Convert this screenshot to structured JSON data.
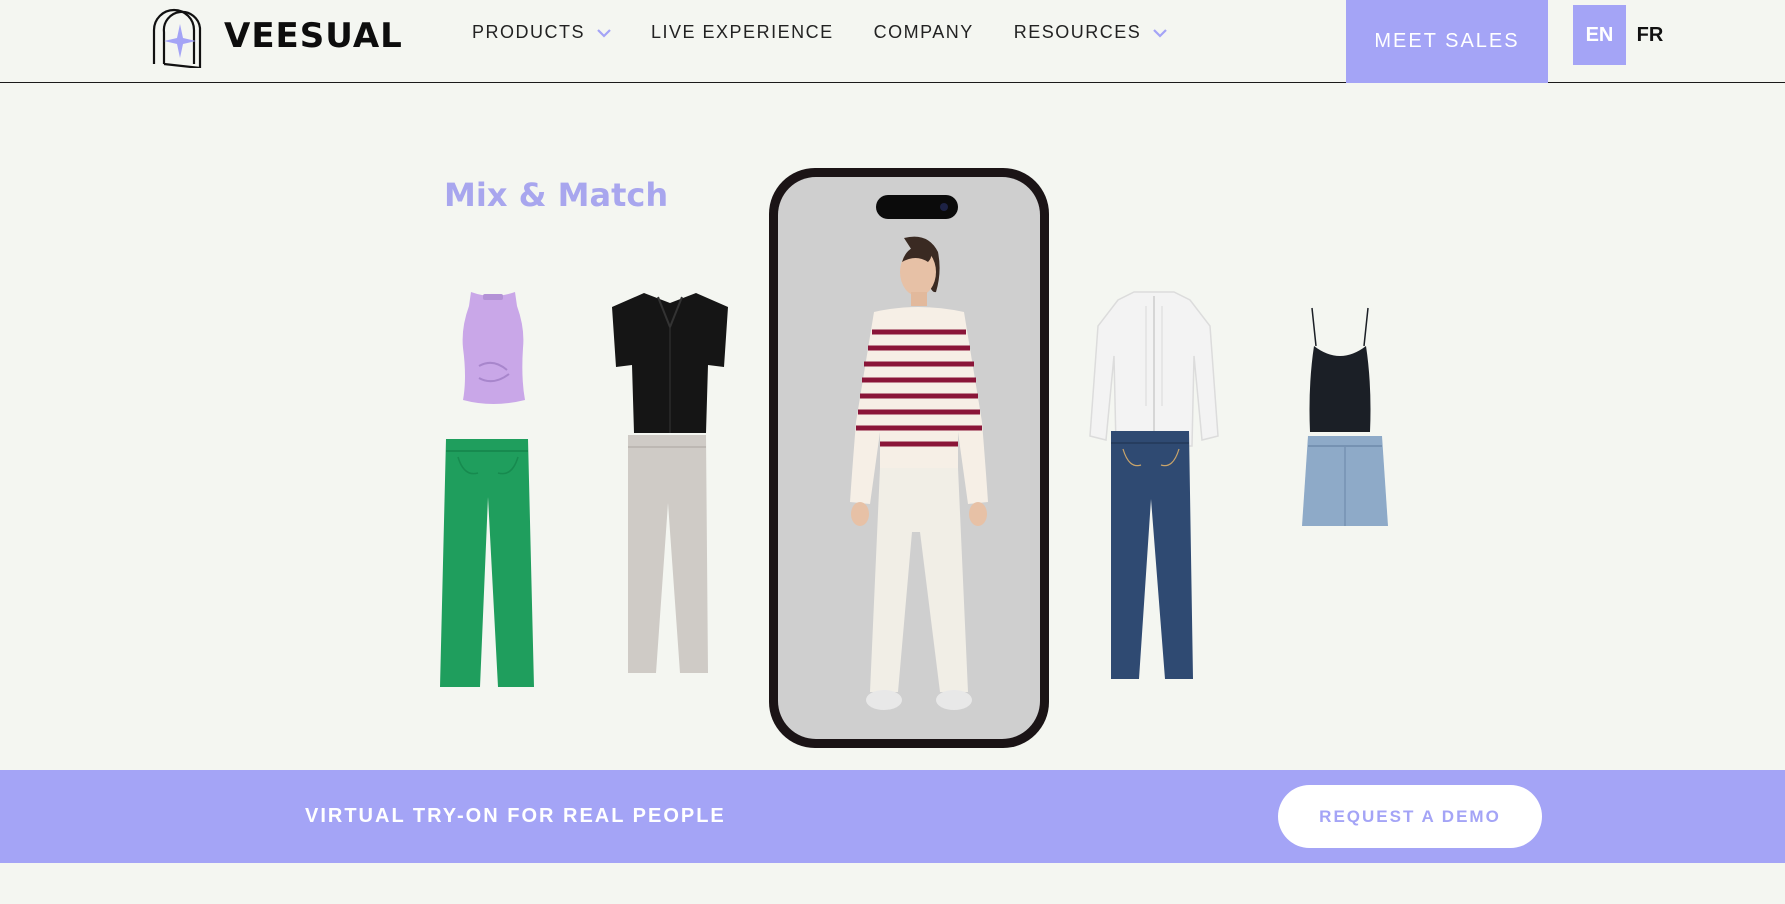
{
  "header": {
    "brand": "VEESUAL",
    "nav": [
      {
        "label": "PRODUCTS",
        "has_dropdown": true
      },
      {
        "label": "LIVE EXPERIENCE",
        "has_dropdown": false
      },
      {
        "label": "COMPANY",
        "has_dropdown": false
      },
      {
        "label": "RESOURCES",
        "has_dropdown": true
      }
    ],
    "cta": "MEET SALES",
    "languages": {
      "active": "EN",
      "other": "FR"
    }
  },
  "showcase": {
    "title": "Mix & Match",
    "garments": [
      {
        "name": "lilac-twist-top",
        "color": "#c9a7e8"
      },
      {
        "name": "green-jeans",
        "color": "#1f9e5d"
      },
      {
        "name": "black-shirt",
        "color": "#151515"
      },
      {
        "name": "grey-trousers",
        "color": "#cfcbc6"
      },
      {
        "name": "white-ruffle-blouse",
        "color": "#f3f3f3"
      },
      {
        "name": "blue-jeans",
        "color": "#2f4a72"
      },
      {
        "name": "black-camisole",
        "color": "#1b1f26"
      },
      {
        "name": "denim-skirt",
        "color": "#8eaac8"
      }
    ],
    "model": {
      "sweater_color": "#f6efe6",
      "stripe_color": "#8a1538",
      "pants_color": "#f1eee6"
    }
  },
  "banner": {
    "tagline": "VIRTUAL TRY-ON FOR REAL PEOPLE",
    "cta": "REQUEST A DEMO"
  },
  "colors": {
    "accent": "#a4a4f6",
    "background": "#f4f6f1",
    "text": "#111111"
  }
}
